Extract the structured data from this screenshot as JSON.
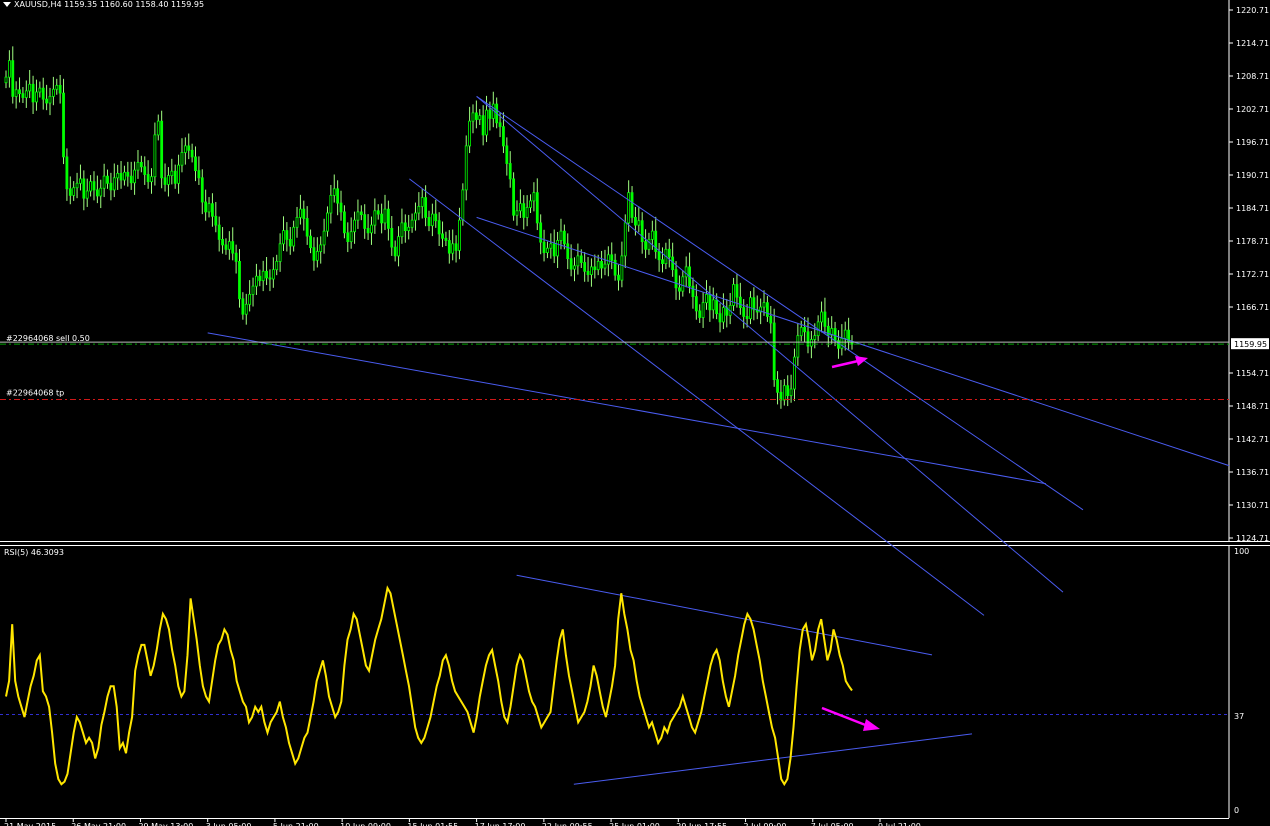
{
  "window": {
    "header": "XAUUSD,H4  1159.35 1160.60 1158.40 1159.95",
    "menu_icon": "triangle-down-icon"
  },
  "orders": {
    "sell_label": "#22964068 sell 0.50",
    "tp_label": "#22964068 tp",
    "price_tag": "1159.95"
  },
  "rsi_panel": {
    "title": "RSI(5) 46.3093",
    "levels": [
      "100",
      "37",
      "0"
    ]
  },
  "colors": {
    "background": "#000000",
    "candle_up": "#00ff00",
    "candle_wick": "#a0ff80",
    "trendline": "#4a5cf0",
    "rsi_line": "#ffe600",
    "arrow": "#ff00ff",
    "sell_line": "#00a000",
    "tp_line": "#d01818",
    "axis": "#ffffff"
  },
  "chart_data": [
    {
      "type": "candlestick",
      "symbol": "XAUUSD",
      "timeframe": "H4",
      "ylim": [
        1124.71,
        1220.71
      ],
      "yticks": [
        "1220.71",
        "1214.71",
        "1208.71",
        "1202.71",
        "1196.71",
        "1190.71",
        "1184.71",
        "1178.71",
        "1172.71",
        "1166.71",
        "1154.71",
        "1148.71",
        "1142.71",
        "1136.71",
        "1130.71",
        "1124.71"
      ],
      "xticks": [
        "21 May 2015",
        "26 May 21:00",
        "29 May 13:00",
        "3 Jun 05:00",
        "5 Jun 21:00",
        "10 Jun 09:00",
        "15 Jun 01:55",
        "17 Jun 17:00",
        "22 Jun 09:55",
        "25 Jun 01:00",
        "29 Jun 17:55",
        "2 Jul 09:00",
        "7 Jul 05:00",
        "9 Jul 21:00"
      ],
      "last_price": 1159.95,
      "sell_order_price": 1159.95,
      "tp_price": 1149.9,
      "close_series": [
        1208.5,
        1211.5,
        1205.0,
        1206.2,
        1205.5,
        1204.8,
        1206.0,
        1207.2,
        1204.0,
        1205.8,
        1206.5,
        1204.5,
        1203.8,
        1205.0,
        1206.3,
        1207.0,
        1205.6,
        1194.0,
        1188.2,
        1187.0,
        1188.4,
        1189.2,
        1190.0,
        1186.5,
        1187.8,
        1189.5,
        1188.0,
        1186.9,
        1188.3,
        1190.5,
        1189.2,
        1188.0,
        1190.2,
        1191.0,
        1189.8,
        1191.2,
        1190.5,
        1189.3,
        1191.6,
        1193.0,
        1192.2,
        1190.8,
        1189.5,
        1190.4,
        1198.0,
        1200.5,
        1190.2,
        1189.0,
        1190.6,
        1191.4,
        1189.2,
        1192.5,
        1194.8,
        1196.0,
        1195.2,
        1194.0,
        1191.5,
        1190.2,
        1185.8,
        1184.0,
        1185.5,
        1183.2,
        1181.6,
        1179.0,
        1178.0,
        1177.2,
        1178.6,
        1176.5,
        1175.0,
        1168.2,
        1165.4,
        1167.2,
        1169.0,
        1170.5,
        1172.3,
        1171.5,
        1173.2,
        1172.0,
        1171.8,
        1173.5,
        1175.0,
        1178.2,
        1180.6,
        1179.0,
        1177.8,
        1181.2,
        1183.0,
        1184.5,
        1182.8,
        1179.6,
        1177.5,
        1175.2,
        1176.8,
        1178.0,
        1180.5,
        1183.8,
        1187.0,
        1188.2,
        1185.6,
        1184.0,
        1180.2,
        1178.6,
        1180.4,
        1182.5,
        1184.0,
        1183.5,
        1181.0,
        1180.2,
        1181.6,
        1184.2,
        1183.6,
        1182.0,
        1184.5,
        1181.0,
        1177.6,
        1176.0,
        1179.5,
        1182.0,
        1180.6,
        1181.2,
        1182.5,
        1183.8,
        1185.0,
        1186.6,
        1183.0,
        1181.5,
        1183.6,
        1182.4,
        1180.0,
        1179.2,
        1178.8,
        1176.5,
        1178.2,
        1177.0,
        1182.5,
        1188.0,
        1196.0,
        1200.5,
        1202.0,
        1200.8,
        1201.5,
        1198.0,
        1202.5,
        1201.0,
        1203.6,
        1200.2,
        1199.5,
        1196.0,
        1192.8,
        1190.0,
        1183.4,
        1184.2,
        1185.5,
        1183.0,
        1184.8,
        1186.0,
        1187.5,
        1182.0,
        1178.5,
        1176.6,
        1177.4,
        1178.2,
        1176.0,
        1178.8,
        1180.5,
        1178.2,
        1175.5,
        1173.6,
        1174.2,
        1176.0,
        1174.8,
        1173.2,
        1172.6,
        1174.0,
        1173.5,
        1175.0,
        1173.8,
        1174.5,
        1176.2,
        1175.2,
        1172.5,
        1171.6,
        1176.0,
        1182.0,
        1187.5,
        1183.0,
        1181.6,
        1182.4,
        1178.6,
        1177.2,
        1179.0,
        1180.5,
        1176.8,
        1175.3,
        1174.6,
        1177.2,
        1175.8,
        1173.5,
        1170.2,
        1169.6,
        1172.2,
        1174.0,
        1170.5,
        1168.6,
        1166.0,
        1164.8,
        1167.5,
        1169.0,
        1166.2,
        1168.0,
        1165.5,
        1164.0,
        1166.6,
        1165.2,
        1167.0,
        1170.8,
        1168.5,
        1166.6,
        1165.0,
        1164.6,
        1168.4,
        1166.2,
        1165.8,
        1166.7,
        1167.5,
        1165.0,
        1163.8,
        1153.5,
        1151.2,
        1149.8,
        1152.4,
        1150.6,
        1151.8,
        1157.6,
        1161.5,
        1163.0,
        1162.2,
        1159.6,
        1160.8,
        1161.5,
        1164.0,
        1165.8,
        1163.2,
        1161.6,
        1162.8,
        1160.6,
        1159.2,
        1161.0,
        1162.5,
        1160.4,
        1159.95
      ],
      "trendlines": [
        {
          "from": [
            "17 Jun 17:00",
            1205.0
          ],
          "to": [
            "9 Jul 21:00",
            1155.0
          ]
        },
        {
          "from": [
            "17 Jun 17:00",
            1205.0
          ],
          "to": [
            "9 Jul 21:00",
            1143.0
          ]
        },
        {
          "from": [
            "15 Jun 01:55",
            1190.0
          ],
          "to": [
            "9 Jul 21:00",
            1125.0
          ]
        },
        {
          "from": [
            "17 Jun 17:00",
            1183.0
          ],
          "to": [
            "9 Jul 21:00",
            1158.8
          ]
        },
        {
          "from": [
            "3 Jun 05:00",
            1162.0
          ],
          "to": [
            "9 Jul 21:00",
            1140.0
          ]
        }
      ]
    },
    {
      "type": "line",
      "name": "RSI(5)",
      "ylim": [
        0,
        100
      ],
      "level": 37,
      "last_value": 46.3093,
      "values": [
        44,
        50,
        72,
        50,
        44,
        40,
        36,
        42,
        48,
        52,
        58,
        60,
        46,
        44,
        40,
        30,
        18,
        12,
        10,
        11,
        14,
        22,
        30,
        36,
        34,
        30,
        26,
        28,
        26,
        20,
        24,
        33,
        38,
        44,
        48,
        48,
        40,
        24,
        26,
        22,
        30,
        36,
        54,
        60,
        64,
        64,
        58,
        52,
        56,
        62,
        70,
        76,
        74,
        70,
        62,
        56,
        48,
        44,
        46,
        60,
        82,
        74,
        66,
        56,
        48,
        44,
        42,
        50,
        58,
        64,
        66,
        70,
        68,
        62,
        58,
        50,
        46,
        42,
        40,
        34,
        36,
        40,
        38,
        40,
        34,
        30,
        34,
        36,
        38,
        42,
        36,
        32,
        26,
        22,
        18,
        20,
        24,
        28,
        30,
        36,
        42,
        50,
        54,
        58,
        52,
        44,
        40,
        36,
        38,
        42,
        56,
        66,
        70,
        76,
        74,
        68,
        62,
        56,
        54,
        60,
        66,
        70,
        74,
        80,
        86,
        84,
        78,
        72,
        66,
        60,
        54,
        48,
        40,
        32,
        28,
        26,
        28,
        32,
        36,
        42,
        48,
        52,
        58,
        60,
        56,
        50,
        46,
        44,
        42,
        40,
        38,
        34,
        30,
        36,
        44,
        50,
        56,
        60,
        62,
        56,
        50,
        42,
        36,
        34,
        40,
        48,
        56,
        60,
        58,
        52,
        46,
        42,
        40,
        36,
        32,
        34,
        36,
        38,
        48,
        58,
        66,
        70,
        60,
        52,
        46,
        40,
        34,
        36,
        38,
        42,
        48,
        56,
        52,
        46,
        40,
        36,
        42,
        48,
        56,
        74,
        84,
        76,
        70,
        62,
        58,
        50,
        44,
        40,
        36,
        32,
        34,
        30,
        26,
        28,
        32,
        30,
        34,
        36,
        38,
        40,
        44,
        40,
        36,
        32,
        30,
        34,
        38,
        44,
        50,
        56,
        60,
        62,
        58,
        50,
        44,
        40,
        46,
        52,
        60,
        66,
        72,
        76,
        74,
        70,
        64,
        58,
        50,
        44,
        38,
        32,
        28,
        20,
        12,
        10,
        12,
        20,
        32,
        48,
        62,
        70,
        72,
        66,
        58,
        62,
        70,
        74,
        66,
        58,
        62,
        70,
        66,
        60,
        56,
        50,
        48,
        46.3
      ],
      "trendlines": [
        {
          "from": [
            "17 Jun 17:00",
            91
          ],
          "to": [
            "9 Jul 21:00",
            64
          ]
        },
        {
          "from": [
            "22 Jun 09:55",
            10
          ],
          "to": [
            "9 Jul 21:00",
            25
          ]
        }
      ]
    }
  ]
}
